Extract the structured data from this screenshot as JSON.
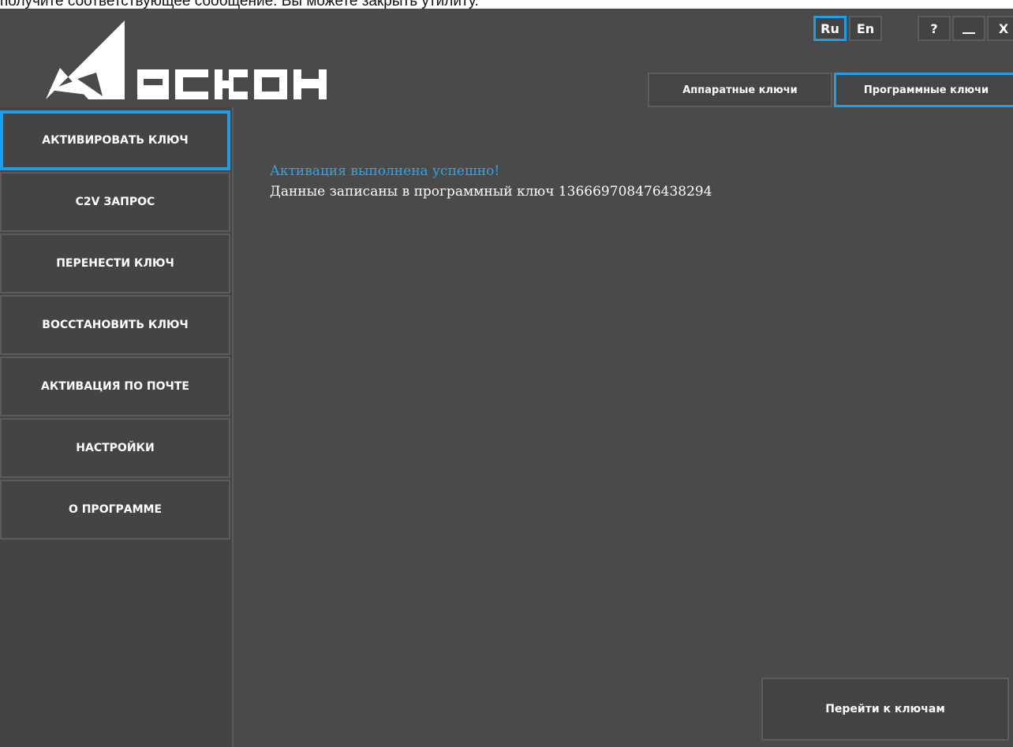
{
  "caption": "получите соответствующее сообщение. Вы можете закрыть утилиту.",
  "brand": {
    "icon": "askon-logo-icon",
    "color": "#ffffff"
  },
  "window_controls": {
    "lang_ru": "Ru",
    "lang_en": "En",
    "help": "?",
    "minimize_icon": "minimize-icon",
    "close": "X",
    "active_color": "#1e9ee8"
  },
  "tabs": [
    {
      "label": "Аппаратные ключи",
      "active": false
    },
    {
      "label": "Программные ключи",
      "active": true
    }
  ],
  "sidebar": {
    "items": [
      {
        "label": "АКТИВИРОВАТЬ КЛЮЧ",
        "active": true
      },
      {
        "label": "C2V ЗАПРОС",
        "active": false
      },
      {
        "label": "ПЕРЕНЕСТИ КЛЮЧ",
        "active": false
      },
      {
        "label": "ВОССТАНОВИТЬ КЛЮЧ",
        "active": false
      },
      {
        "label": "АКТИВАЦИЯ ПО ПОЧТЕ",
        "active": false
      },
      {
        "label": "НАСТРОЙКИ",
        "active": false
      },
      {
        "label": "О ПРОГРАММЕ",
        "active": false
      }
    ]
  },
  "content": {
    "success_message": "Активация выполнена успешно!",
    "detail_message": "Данные записаны в программный ключ 1366697084764382​94",
    "go_to_keys_label": "Перейти к ключам"
  }
}
